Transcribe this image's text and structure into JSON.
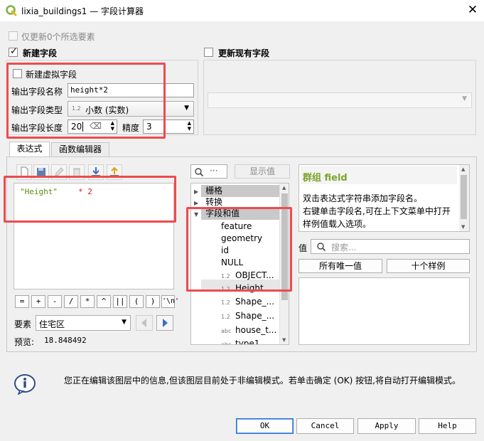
{
  "window": {
    "title": "lixia_buildings1 — 字段计算器",
    "close_glyph": "✕"
  },
  "only_selected": {
    "label": "仅更新0个所选要素"
  },
  "create_field": {
    "label": "新建字段",
    "checked": true
  },
  "update_field": {
    "label": "更新现有字段",
    "checked": false
  },
  "virtual_field": {
    "label": "新建虚拟字段"
  },
  "output": {
    "name_label": "输出字段名称",
    "name_value": "height*2",
    "type_label": "输出字段类型",
    "type_icon": "1.2",
    "type_value": "小数 (实数)",
    "length_label": "输出字段长度",
    "length_value": "20",
    "precision_label": "精度",
    "precision_value": "3"
  },
  "tabs": [
    "表达式",
    "函数编辑器"
  ],
  "expression": {
    "field": "\"Height\"",
    "op": "* 2"
  },
  "operators": [
    "=",
    "+",
    "-",
    "/",
    "*",
    "^",
    "||",
    "(",
    ")",
    "'\\n'"
  ],
  "feature": {
    "label": "要素",
    "value": "住宅区"
  },
  "preview": {
    "label": "预览:",
    "value": "18.848492"
  },
  "search": {
    "icon_text": "···",
    "show_values": "显示值"
  },
  "tree": {
    "groups": [
      "栅格",
      "转换",
      "字段和值"
    ],
    "items": [
      {
        "type": "",
        "name": "feature"
      },
      {
        "type": "",
        "name": "geometry"
      },
      {
        "type": "",
        "name": "id"
      },
      {
        "type": "",
        "name": "NULL"
      },
      {
        "type": "1.2",
        "name": "OBJECT..."
      },
      {
        "type": "1.2",
        "name": "Height"
      },
      {
        "type": "1.2",
        "name": "Shape_..."
      },
      {
        "type": "1.2",
        "name": "Shape_..."
      },
      {
        "type": "abc",
        "name": "house_t..."
      },
      {
        "type": "abc",
        "name": "type1"
      }
    ]
  },
  "help": {
    "title": "群组 field",
    "lines": [
      "双击表达式字符串添加字段名。",
      "右键单击字段名,可在上下文菜单中打开样例值载入选项。"
    ]
  },
  "values": {
    "label": "值",
    "search_placeholder": "搜索...",
    "all_unique": "所有唯一值",
    "ten_samples": "十个样例"
  },
  "info": {
    "text": "您正在编辑该图层中的信息,但该图层目前处于非编辑模式。若单击确定 (OK) 按钮,将自动打开编辑模式。"
  },
  "buttons": {
    "ok": "OK",
    "cancel": "Cancel",
    "apply": "Apply",
    "help": "Help"
  },
  "colors": {
    "highlight": "#ed4b4e",
    "field_string": "#5c8c18",
    "operator": "#cc2222",
    "help_title": "#7ca32a"
  }
}
